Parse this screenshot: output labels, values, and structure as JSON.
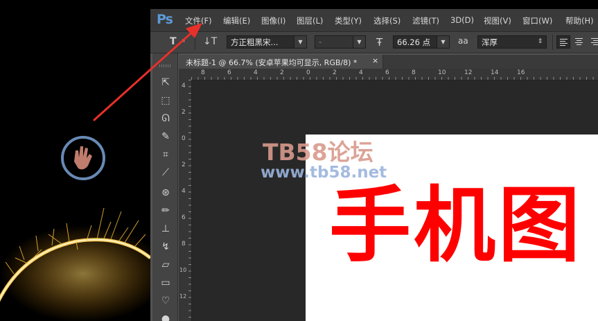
{
  "app": {
    "logo": "Ps"
  },
  "menu": [
    "文件(F)",
    "编辑(E)",
    "图像(I)",
    "图层(L)",
    "类型(Y)",
    "选择(S)",
    "滤镜(T)",
    "3D(D)",
    "视图(V)",
    "窗口(W)",
    "帮助(H)"
  ],
  "options_bar": {
    "tool_icon": "type-tool-icon",
    "orientation_icon": "toggle-text-orientation-icon",
    "font_family": "方正粗黑宋...",
    "font_style": "-",
    "size_icon": "font-size-icon",
    "font_size": "66.26 点",
    "aa_icon": "aa",
    "anti_alias": "浑厚"
  },
  "document_tab": {
    "title": "未标题-1 @ 66.7% (安卓苹果均可显示, RGB/8) *",
    "close": "×"
  },
  "ruler": {
    "horizontal": [
      "8",
      "6",
      "4",
      "2",
      "0",
      "2",
      "4",
      "6",
      "8",
      "10",
      "12",
      "14",
      "16"
    ],
    "vertical": [
      "4",
      "2",
      "0",
      "2",
      "4",
      "6",
      "8",
      "10",
      "12"
    ]
  },
  "canvas": {
    "text": "手机图",
    "text_color": "#FF0000",
    "background": "#FFFFFF"
  },
  "watermark": {
    "brand": "TB58论坛",
    "url": "www.tb58.net"
  },
  "colors": {
    "ps_blue": "#5D9AD6",
    "annotation_arrow": "#E8302A"
  }
}
